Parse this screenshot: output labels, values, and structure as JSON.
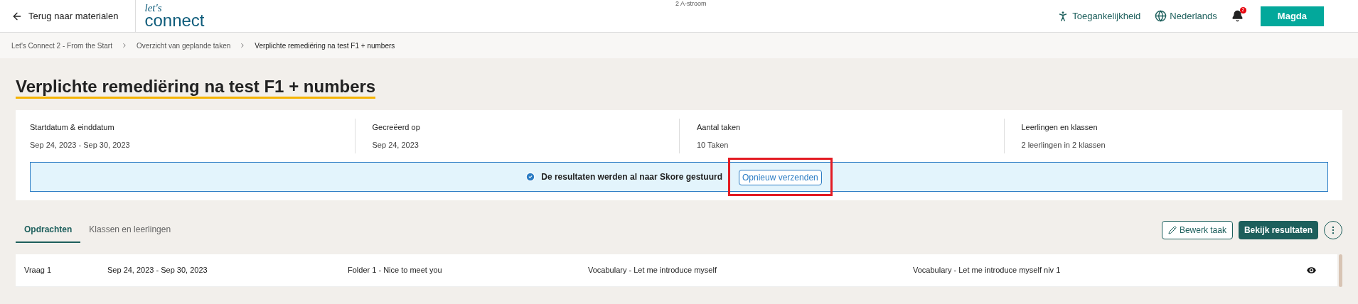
{
  "header": {
    "back_link": "Terug naar materialen",
    "logo": {
      "top": "let's",
      "bottom": "connect"
    },
    "subtitle": "2 A-stroom",
    "accessibility": "Toegankelijkheid",
    "language": "Nederlands",
    "notifications": "2",
    "user": "Magda"
  },
  "breadcrumbs": [
    {
      "label": "Let's Connect 2 - From the Start",
      "current": false
    },
    {
      "label": "Overzicht van geplande taken",
      "current": false
    },
    {
      "label": "Verplichte remediëring na test F1 + numbers",
      "current": true
    }
  ],
  "title": "Verplichte remediëring na test F1 + numbers",
  "summary": [
    {
      "label": "Startdatum & einddatum",
      "value": "Sep 24, 2023 - Sep 30, 2023"
    },
    {
      "label": "Gecreëerd op",
      "value": "Sep 24, 2023"
    },
    {
      "label": "Aantal taken",
      "value": "10 Taken"
    },
    {
      "label": "Leerlingen en klassen",
      "value": "2 leerlingen in 2 klassen"
    }
  ],
  "notice": {
    "message": "De resultaten werden al naar Skore gestuurd",
    "button": "Opnieuw verzenden",
    "highlighted": true
  },
  "tabs": [
    {
      "label": "Opdrachten",
      "selected": true
    },
    {
      "label": "Klassen en leerlingen",
      "selected": false
    }
  ],
  "actions": {
    "edit": "Bewerk taak",
    "results": "Bekijk resultaten"
  },
  "rows": [
    {
      "name": "Vraag 1",
      "dates": "Sep 24, 2023 - Sep 30, 2023",
      "folder": "Folder 1 - Nice to meet you",
      "lesson": "Vocabulary - Let me introduce myself",
      "exercise": "Vocabulary - Let me introduce myself niv 1"
    }
  ]
}
